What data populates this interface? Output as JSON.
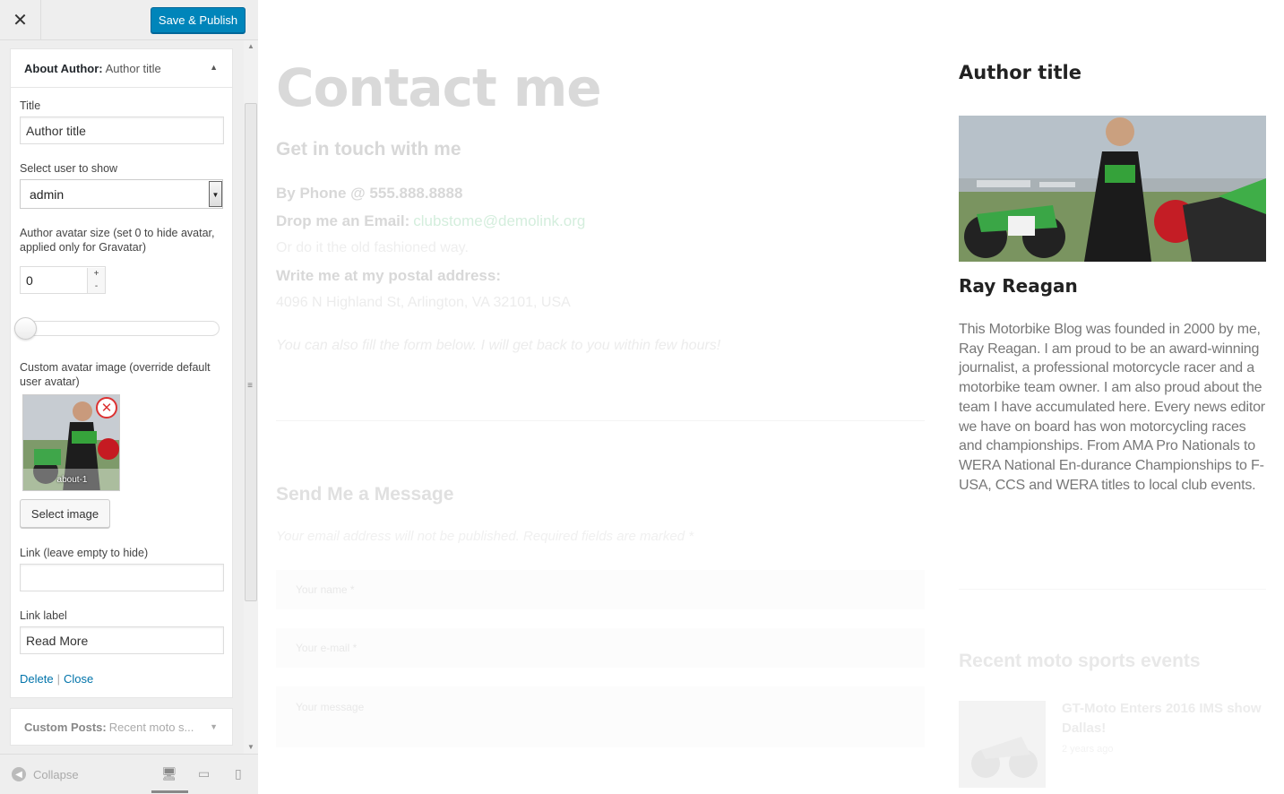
{
  "sidebar": {
    "close_icon": "close-icon",
    "publish_label": "Save & Publish",
    "widget_author": {
      "title_bold": "About Author:",
      "title_sub": "Author title",
      "title_label": "Title",
      "title_value": "Author title",
      "select_user_label": "Select user to show",
      "select_user_value": "admin",
      "avatar_size_label": "Author avatar size (set 0 to hide avatar, applied only for Gravatar)",
      "avatar_size_value": "0",
      "custom_avatar_label": "Custom avatar image (override default user avatar)",
      "avatar_caption": "about-1",
      "select_image_label": "Select image",
      "link_label": "Link (leave empty to hide)",
      "link_value": "",
      "link_label_label": "Link label",
      "link_label_value": "Read More",
      "delete_label": "Delete",
      "sep": "|",
      "close_label": "Close"
    },
    "widget_custom": {
      "title_bold": "Custom Posts:",
      "title_sub": "Recent moto s..."
    },
    "footer": {
      "collapse_label": "Collapse"
    }
  },
  "preview": {
    "page_title": "Contact me",
    "subtitle": "Get in touch with me",
    "phone": "By Phone @ 555.888.8888",
    "email_label": "Drop me an Email:",
    "email_link": "clubstome@demolink.org",
    "old_fashioned": "Or do it the old fashioned way.",
    "postal_label": "Write me at my postal address:",
    "address": "4096 N Highland St, Arlington, VA 32101, USA",
    "note": "You can also fill the form below. I will get back to you within few hours!",
    "send_title": "Send Me a Message",
    "required_note": "Your email address will not be published. Required fields are marked *",
    "name_placeholder": "Your name *",
    "email_placeholder": "Your e-mail *",
    "message_placeholder": "Your message",
    "author_widget_title": "Author title",
    "author_name": "Ray Reagan",
    "author_bio": "This Motorbike Blog was founded in 2000 by me, Ray Reagan. I am proud to be an award-winning journalist, a professional motorcycle racer and a motorbike team owner. I am also proud about the team I have accumulated here. Every news editor we have on board has won motorcycling races and championships. From AMA Pro Nationals to WERA National En-durance Championships to F-USA, CCS and WERA titles to local club events.",
    "recent_title": "Recent moto sports events",
    "recent_post_title": "GT-Moto Enters 2016 IMS show Dallas!",
    "recent_post_date": "2 years ago"
  },
  "colors": {
    "primary_button": "#0085ba",
    "link": "#0073aa",
    "remove": "#dc3232"
  }
}
